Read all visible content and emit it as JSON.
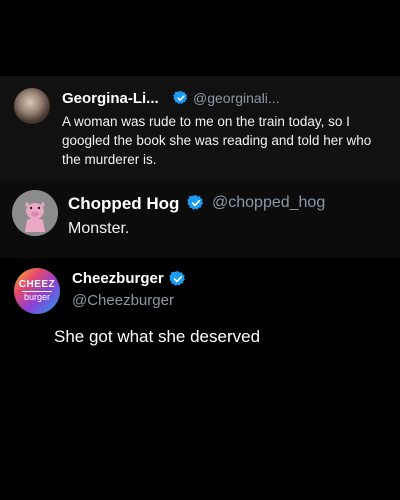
{
  "tweets": [
    {
      "name": "Georgina-Li...",
      "handle": "@georginali...",
      "text": "A woman was rude to me on the train today, so I googled the book she was reading and told her who the murderer is.",
      "verified": true
    },
    {
      "name": "Chopped Hog",
      "handle": "@chopped_hog",
      "text": "Monster.",
      "verified": true
    },
    {
      "name": "Cheezburger",
      "handle": "@Cheezburger",
      "verified": true,
      "logo_top": "CHEEZ",
      "logo_bottom": "burger"
    }
  ],
  "caption": "She got what she deserved",
  "colors": {
    "background": "#000000",
    "verified": "#1d9bf0",
    "handle": "#8b98a5"
  }
}
